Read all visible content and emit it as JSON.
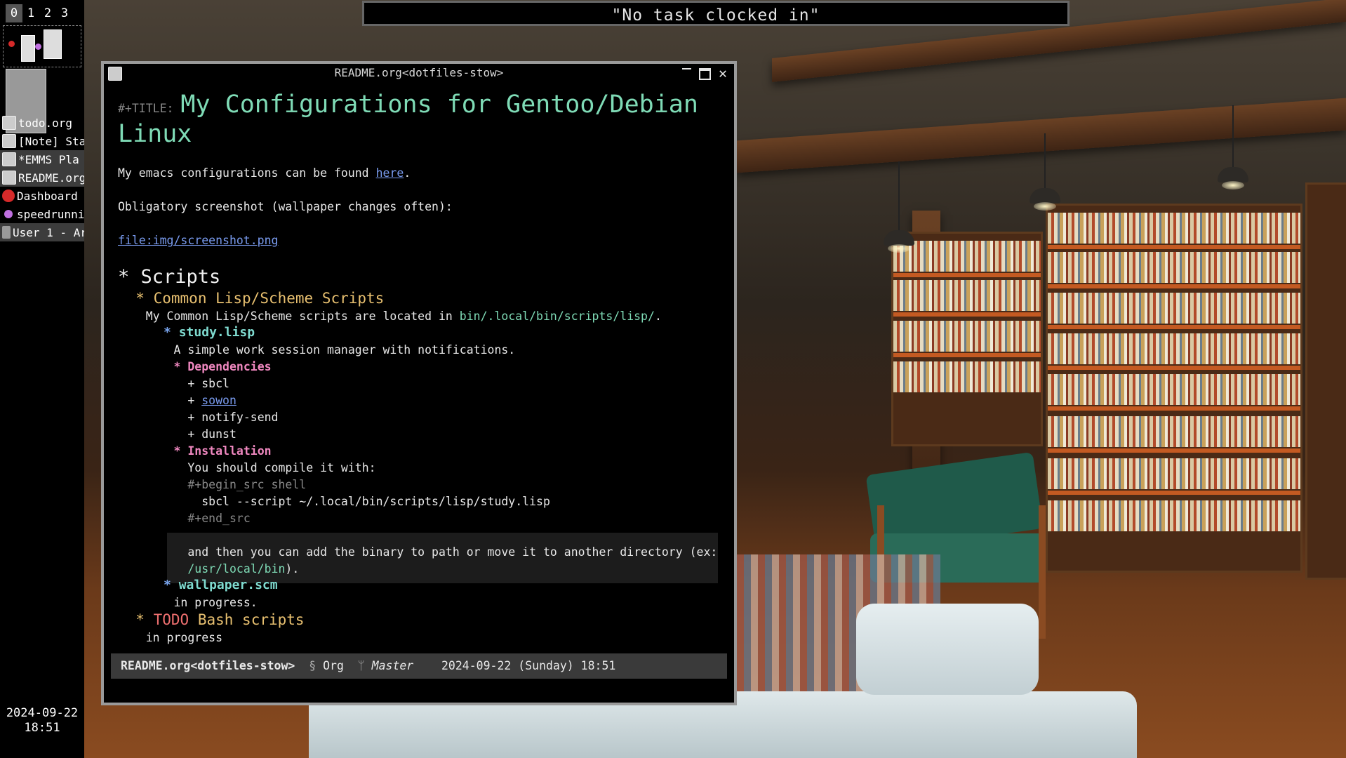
{
  "workspaces": [
    "0",
    "1",
    "2",
    "3"
  ],
  "active_workspace": "0",
  "topbar": {
    "status": "\"No task clocked in\""
  },
  "taskbar": [
    {
      "label": "todo.org",
      "icon": "emacs-icon"
    },
    {
      "label": "[Note] Sta",
      "icon": "emacs-icon"
    },
    {
      "label": " *EMMS Pla",
      "icon": "emacs-icon"
    },
    {
      "label": "README.org",
      "icon": "emacs-icon"
    },
    {
      "label": "Dashboard",
      "icon": "dashboard-icon"
    },
    {
      "label": "speedrunnin",
      "icon": "speedrun-icon"
    },
    {
      "label": "User 1 - Ar",
      "icon": "user-app-icon"
    }
  ],
  "clock": {
    "date": "2024-09-22",
    "time": "18:51"
  },
  "window": {
    "title": "README.org<dotfiles-stow>",
    "buttons": {
      "minimize": "minimize-icon",
      "maximize": "maximize-icon",
      "close": "close-icon"
    }
  },
  "doc": {
    "title_keyword": "#+TITLE:",
    "title_line1": "My Configurations for Gentoo/Debian",
    "title_line2": "Linux",
    "p1_pre": "My emacs configurations can be found ",
    "p1_link": "here",
    "p1_post": ".",
    "p2": "Obligatory screenshot (wallpaper changes often):",
    "p3_link": "file:img/screenshot.png",
    "h_scripts": "Scripts",
    "h_lisp": "Common Lisp/Scheme Scripts",
    "lisp_desc_pre": "My Common Lisp/Scheme scripts are located in ",
    "lisp_desc_path": "bin/.local/bin/scripts/lisp/",
    "lisp_desc_post": ".",
    "h_study": "study.lisp",
    "study_desc": "A simple work session manager with notifications.",
    "h_deps": "Dependencies",
    "deps": [
      "sbcl",
      "sowon",
      "notify-send",
      "dunst"
    ],
    "h_install": "Installation",
    "install_text": "You should compile it with:",
    "src_begin": "#+begin_src shell",
    "src_line": "sbcl --script ~/.local/bin/scripts/lisp/study.lisp",
    "src_end": "#+end_src",
    "after_text": "and then you can add the binary to path or move it to another directory (ex:",
    "after_path": "/usr/local/bin",
    "after_post": ").",
    "h_wallpaper": "wallpaper.scm",
    "wallpaper_desc": "in progress.",
    "h_bash_todo": "TODO",
    "h_bash": "Bash scripts",
    "bash_desc": "in progress"
  },
  "modeline": {
    "buffer": "README.org<dotfiles-stow>",
    "mode_sym": "§",
    "mode": "Org",
    "branch_sym": "ᛘ",
    "branch": "Master",
    "datetime": "2024-09-22 (Sunday) 18:51"
  },
  "colors": {
    "title": "#7fdbb6",
    "heading2": "#e8c070",
    "heading3": "#7fdbd0",
    "heading4": "#f088c0",
    "link": "#7a9cf0",
    "todo": "#f07070"
  }
}
